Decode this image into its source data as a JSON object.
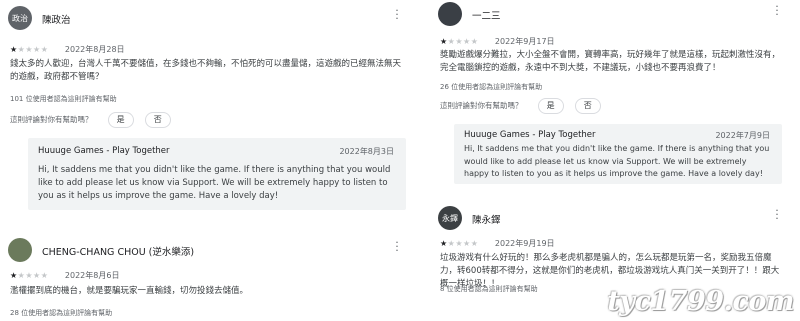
{
  "left": {
    "review1": {
      "avatar_text": "政治",
      "avatar_color": "#5f6368",
      "author": "陳政治",
      "rating": 1,
      "stars_on": "★",
      "stars_off": "★★★★",
      "date": "2022年8月28日",
      "text": "錢太多的人歡迎，台灣人千萬不要儲值，在多錢也不夠輸，不怕死的可以盡量儲，這遊戲的已經無法無天的遊戲，政府都不管嗎？",
      "helpful_count": "101 位使用者認為這則評論有幫助",
      "question": "這則評論對你有幫助嗎？",
      "yes": "是",
      "no": "否",
      "reply": {
        "developer": "Huuuge Games - Play Together",
        "date": "2022年8月3日",
        "text": "Hi, It saddens me that you didn't like the game. If there is anything that you would like to add please let us know via Support. We will be extremely happy to listen to you as it helps us improve the game. Have a lovely day!"
      }
    },
    "review2": {
      "avatar_color": "#6b7a5c",
      "author": "CHENG-CHANG CHOU (逆水樂添)",
      "rating": 1,
      "stars_on": "★",
      "stars_off": "★★★★",
      "date": "2022年8月6日",
      "text": "濫權擺到底的機台，就是要騙玩家一直輸錢，切勿投錢去儲值。",
      "helpful_count": "28 位使用者認為這則評論有幫助"
    }
  },
  "right": {
    "review1": {
      "avatar_color": "#3a3f45",
      "author": "一二三",
      "rating": 1,
      "stars_on": "★",
      "stars_off": "★★★★",
      "date": "2022年9月17日",
      "text": "獎勵遊戲爆分難拉，大小全盤不會開，寶轉率高，玩好幾年了就是這樣，玩起刺激性沒有，完全電腦鎖控的遊戲，永遠中不到大獎，不建議玩，小錢也不要再浪費了！",
      "helpful_count": "26 位使用者認為這則評論有幫助",
      "question": "這則評論對你有幫助嗎？",
      "yes": "是",
      "no": "否",
      "reply": {
        "developer": "Huuuge Games - Play Together",
        "date": "2022年7月9日",
        "text": "Hi, It saddens me that you didn't like the game. If there is anything that you would like to add please let us know via Support. We will be extremely happy to listen to you as it helps us improve the game. Have a lovely day!"
      }
    },
    "review2": {
      "avatar_text": "永鐸",
      "avatar_color": "#3c4043",
      "author": "陳永鐸",
      "rating": 1,
      "stars_on": "★",
      "stars_off": "★★★★",
      "date": "2022年9月19日",
      "text": "垃圾游戏有什么好玩的！那么多老虎机都是骗人的，怎么玩都是玩第一名，奖励我五倍魔力，转600转都不得分，这就是你们的老虎机，都垃圾游戏坑人真门关一关到开了！！跟大概一样垃圾！！",
      "helpful_count": "8 位使用者認為這則評論有幫助"
    }
  },
  "watermark": "tyc1799.com"
}
